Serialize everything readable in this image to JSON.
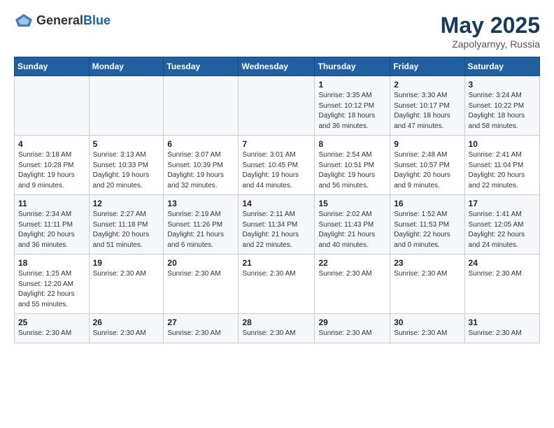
{
  "header": {
    "logo_general": "General",
    "logo_blue": "Blue",
    "title": "May 2025",
    "location": "Zapolyarnyy, Russia"
  },
  "columns": [
    "Sunday",
    "Monday",
    "Tuesday",
    "Wednesday",
    "Thursday",
    "Friday",
    "Saturday"
  ],
  "weeks": [
    [
      {
        "day": "",
        "info": ""
      },
      {
        "day": "",
        "info": ""
      },
      {
        "day": "",
        "info": ""
      },
      {
        "day": "",
        "info": ""
      },
      {
        "day": "1",
        "info": "Sunrise: 3:35 AM\nSunset: 10:12 PM\nDaylight: 18 hours\nand 36 minutes."
      },
      {
        "day": "2",
        "info": "Sunrise: 3:30 AM\nSunset: 10:17 PM\nDaylight: 18 hours\nand 47 minutes."
      },
      {
        "day": "3",
        "info": "Sunrise: 3:24 AM\nSunset: 10:22 PM\nDaylight: 18 hours\nand 58 minutes."
      }
    ],
    [
      {
        "day": "4",
        "info": "Sunrise: 3:18 AM\nSunset: 10:28 PM\nDaylight: 19 hours\nand 9 minutes."
      },
      {
        "day": "5",
        "info": "Sunrise: 3:13 AM\nSunset: 10:33 PM\nDaylight: 19 hours\nand 20 minutes."
      },
      {
        "day": "6",
        "info": "Sunrise: 3:07 AM\nSunset: 10:39 PM\nDaylight: 19 hours\nand 32 minutes."
      },
      {
        "day": "7",
        "info": "Sunrise: 3:01 AM\nSunset: 10:45 PM\nDaylight: 19 hours\nand 44 minutes."
      },
      {
        "day": "8",
        "info": "Sunrise: 2:54 AM\nSunset: 10:51 PM\nDaylight: 19 hours\nand 56 minutes."
      },
      {
        "day": "9",
        "info": "Sunrise: 2:48 AM\nSunset: 10:57 PM\nDaylight: 20 hours\nand 9 minutes."
      },
      {
        "day": "10",
        "info": "Sunrise: 2:41 AM\nSunset: 11:04 PM\nDaylight: 20 hours\nand 22 minutes."
      }
    ],
    [
      {
        "day": "11",
        "info": "Sunrise: 2:34 AM\nSunset: 11:11 PM\nDaylight: 20 hours\nand 36 minutes."
      },
      {
        "day": "12",
        "info": "Sunrise: 2:27 AM\nSunset: 11:18 PM\nDaylight: 20 hours\nand 51 minutes."
      },
      {
        "day": "13",
        "info": "Sunrise: 2:19 AM\nSunset: 11:26 PM\nDaylight: 21 hours\nand 6 minutes."
      },
      {
        "day": "14",
        "info": "Sunrise: 2:11 AM\nSunset: 11:34 PM\nDaylight: 21 hours\nand 22 minutes."
      },
      {
        "day": "15",
        "info": "Sunrise: 2:02 AM\nSunset: 11:43 PM\nDaylight: 21 hours\nand 40 minutes."
      },
      {
        "day": "16",
        "info": "Sunrise: 1:52 AM\nSunset: 11:53 PM\nDaylight: 22 hours\nand 0 minutes."
      },
      {
        "day": "17",
        "info": "Sunrise: 1:41 AM\nSunset: 12:05 AM\nDaylight: 22 hours\nand 24 minutes."
      }
    ],
    [
      {
        "day": "18",
        "info": "Sunrise: 1:25 AM\nSunset: 12:20 AM\nDaylight: 22 hours\nand 55 minutes."
      },
      {
        "day": "19",
        "info": "Sunrise: 2:30 AM"
      },
      {
        "day": "20",
        "info": "Sunrise: 2:30 AM"
      },
      {
        "day": "21",
        "info": "Sunrise: 2:30 AM"
      },
      {
        "day": "22",
        "info": "Sunrise: 2:30 AM"
      },
      {
        "day": "23",
        "info": "Sunrise: 2:30 AM"
      },
      {
        "day": "24",
        "info": "Sunrise: 2:30 AM"
      }
    ],
    [
      {
        "day": "25",
        "info": "Sunrise: 2:30 AM"
      },
      {
        "day": "26",
        "info": "Sunrise: 2:30 AM"
      },
      {
        "day": "27",
        "info": "Sunrise: 2:30 AM"
      },
      {
        "day": "28",
        "info": "Sunrise: 2:30 AM"
      },
      {
        "day": "29",
        "info": "Sunrise: 2:30 AM"
      },
      {
        "day": "30",
        "info": "Sunrise: 2:30 AM"
      },
      {
        "day": "31",
        "info": "Sunrise: 2:30 AM"
      }
    ]
  ]
}
